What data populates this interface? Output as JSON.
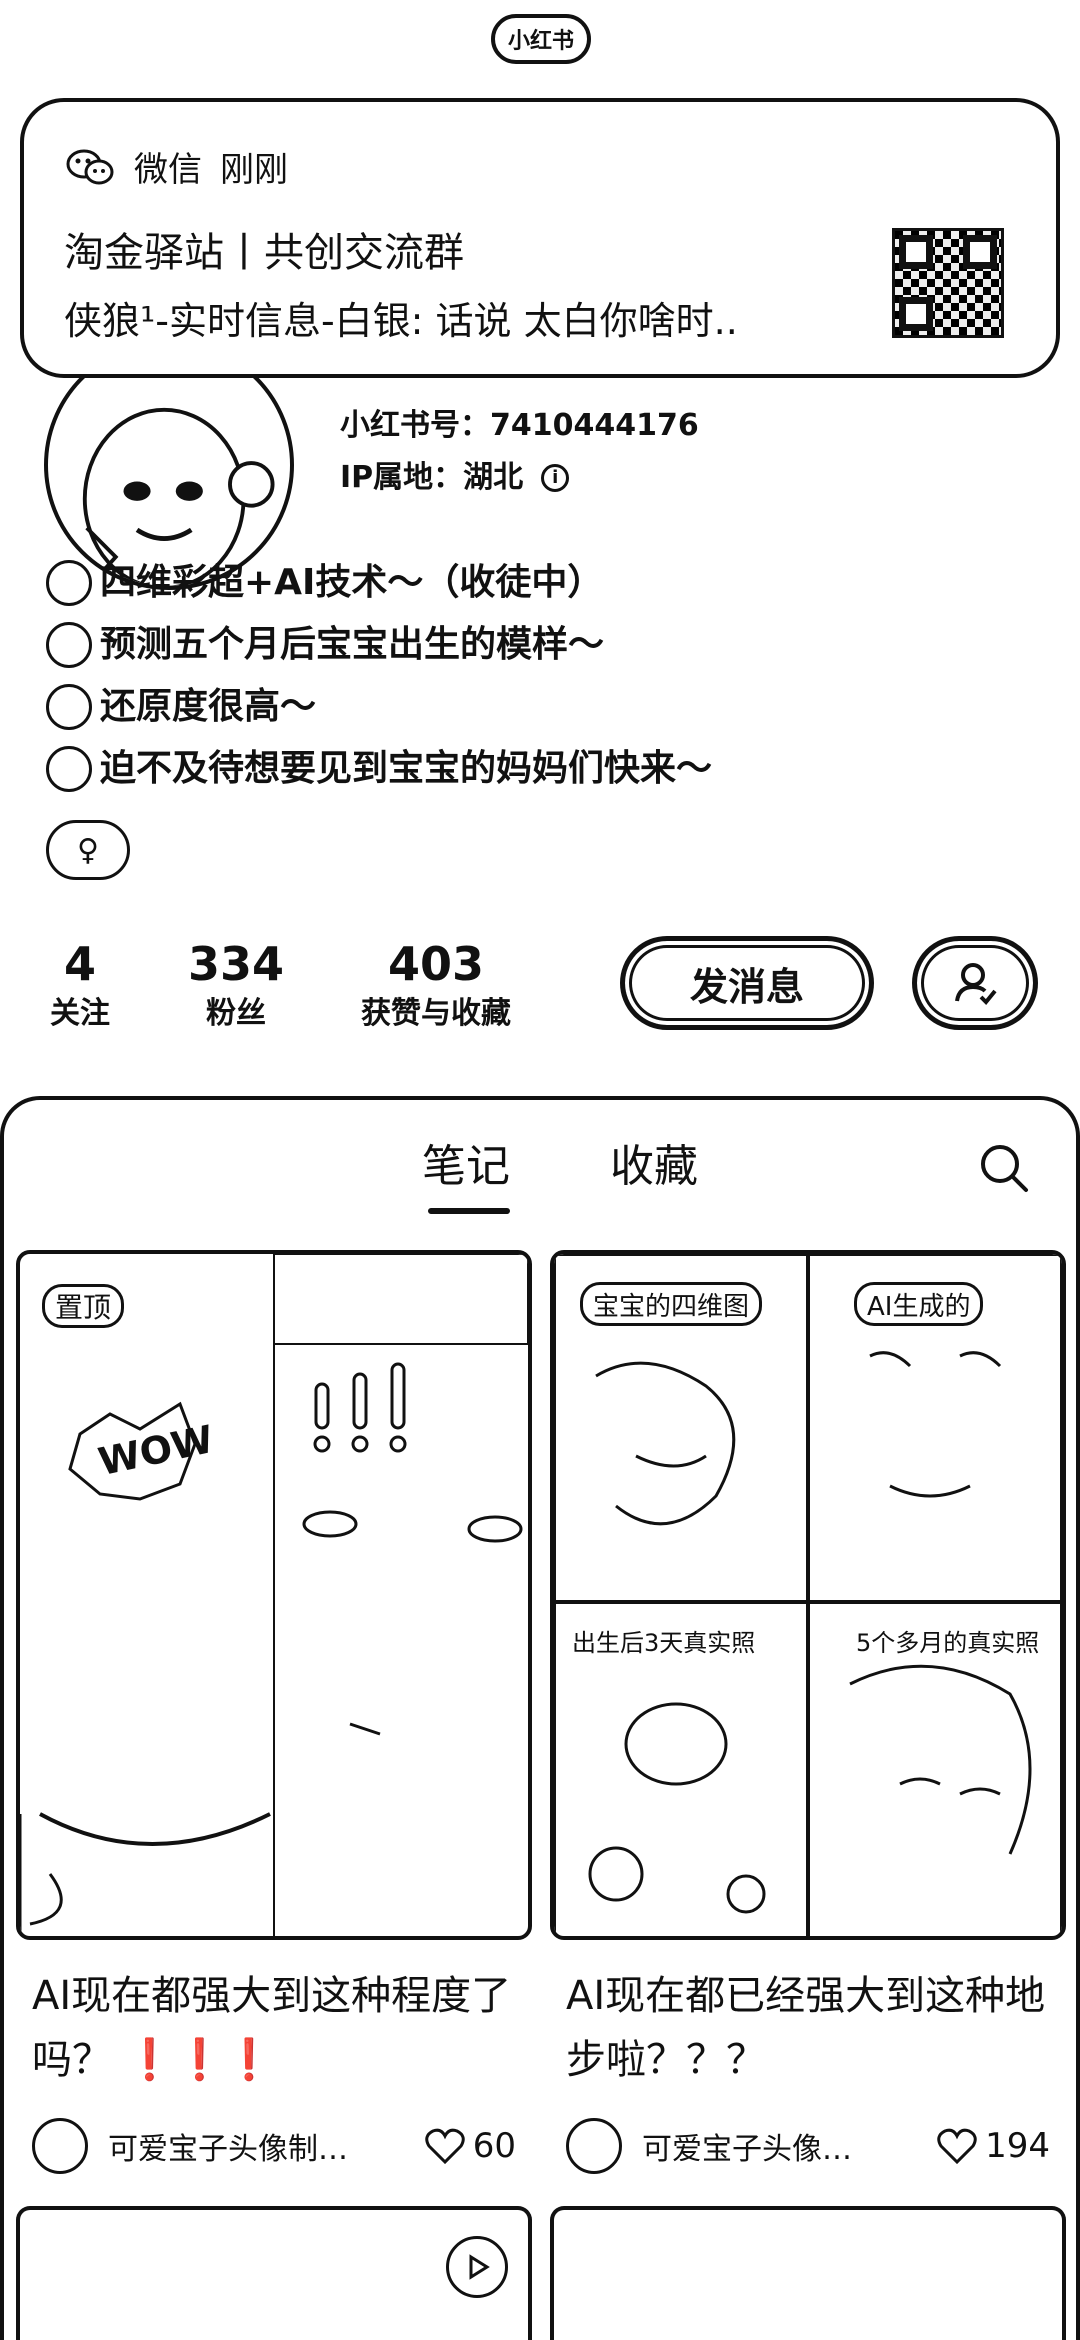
{
  "status_pill": "小红书",
  "notification": {
    "app": "微信",
    "time": "刚刚",
    "title": "淘金驿站丨共创交流群",
    "body": "侠狼¹-实时信息-白银: 话说 太白你啥时.."
  },
  "profile": {
    "id_label": "小红书号：7410444176",
    "ip_label": "IP属地：湖北",
    "bio": [
      "四维彩超+AI技术～（收徒中）",
      "预测五个月后宝宝出生的模样～",
      "还原度很高～",
      "迫不及待想要见到宝宝的妈妈们快来～"
    ],
    "gender_symbol": "♀",
    "stats": [
      {
        "num": "4",
        "label": "关注"
      },
      {
        "num": "334",
        "label": "粉丝"
      },
      {
        "num": "403",
        "label": "获赞与收藏"
      }
    ],
    "message_button": "发消息"
  },
  "tabs": {
    "notes": "笔记",
    "collections": "收藏"
  },
  "notes": [
    {
      "badge": "置顶",
      "title": "AI现在都强大到这种程度了吗？ ❗❗❗",
      "author": "可爱宝子头像制…",
      "likes": "60"
    },
    {
      "labels": [
        "宝宝的四维图",
        "AI生成的",
        "出生后3天真实照",
        "5个多月的真实照"
      ],
      "title": "AI现在都已经强大到这种地步啦？？？",
      "author": "可爱宝子头像…",
      "likes": "194"
    }
  ],
  "colors": {
    "ink": "#111111",
    "paper": "#ffffff"
  }
}
